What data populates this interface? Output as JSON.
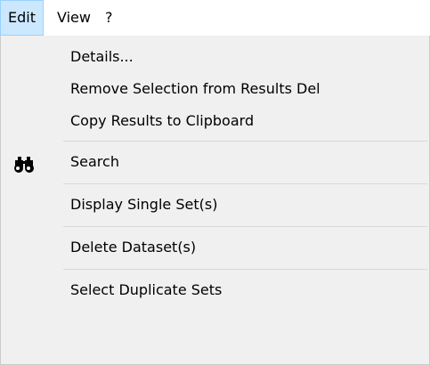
{
  "menubar": {
    "items": [
      {
        "label": "Edit"
      },
      {
        "label": "View"
      },
      {
        "label": "?"
      }
    ]
  },
  "edit_menu": {
    "items": [
      {
        "label": "Details..."
      },
      {
        "label": "Remove Selection from Results Del"
      },
      {
        "label": "Copy Results to Clipboard"
      },
      {
        "label": "Search",
        "icon": "binoculars-icon"
      },
      {
        "label": "Display Single Set(s)"
      },
      {
        "label": "Delete Dataset(s)"
      },
      {
        "label": "Select Duplicate Sets"
      }
    ]
  }
}
